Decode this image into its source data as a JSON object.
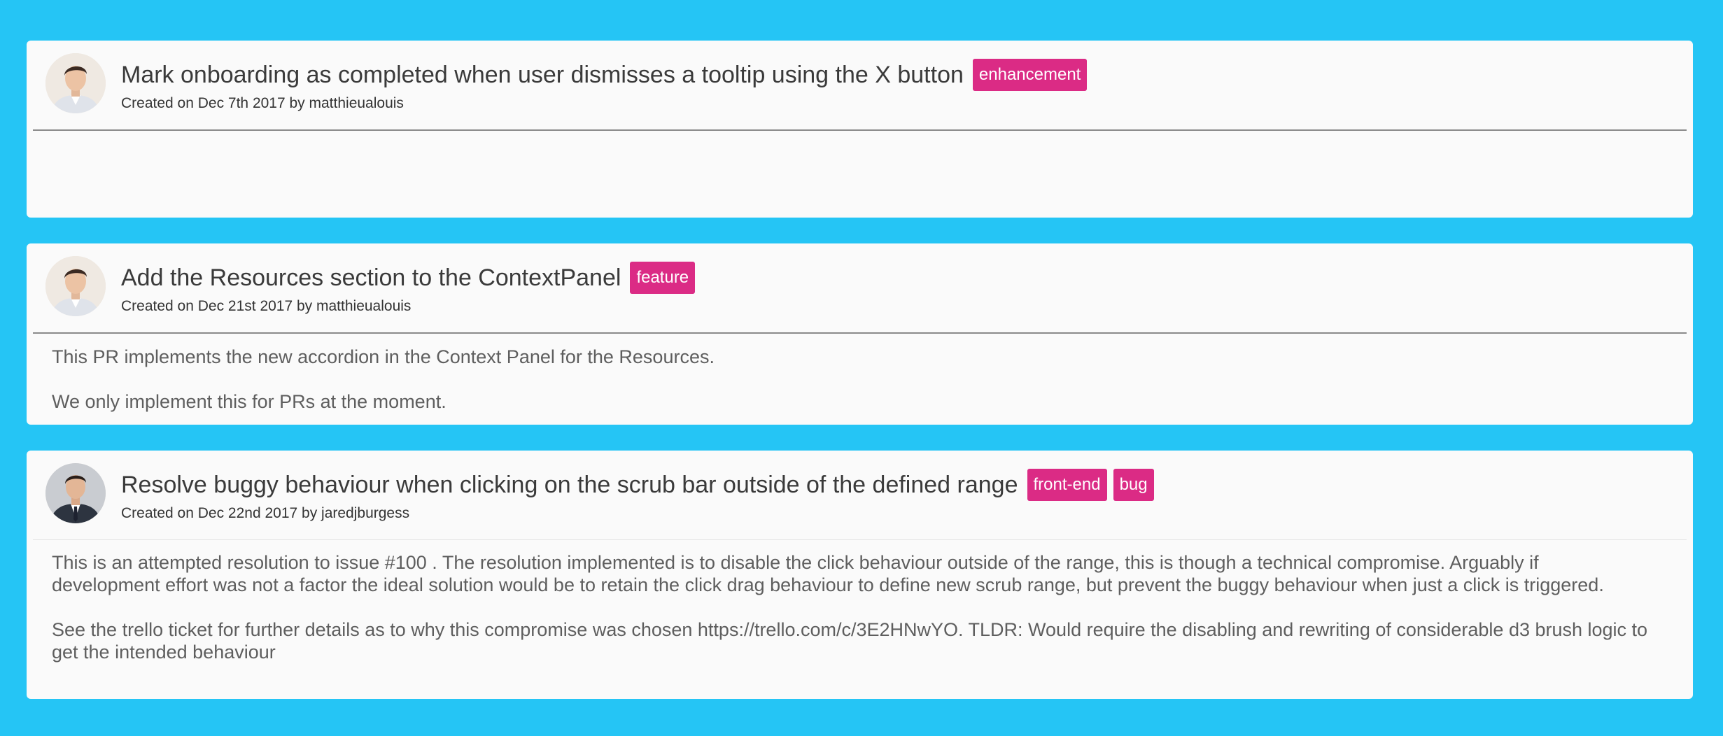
{
  "cards": [
    {
      "title": "Mark onboarding as completed when user dismisses a tooltip using the X button",
      "labels": [
        "enhancement"
      ],
      "meta": "Created on Dec 7th 2017 by matthieualouis",
      "body": [],
      "avatar": "user-avatar-matthieualouis"
    },
    {
      "title": "Add the Resources section to the ContextPanel",
      "labels": [
        "feature"
      ],
      "meta": "Created on Dec 21st 2017 by matthieualouis",
      "body": [
        "This PR implements the new accordion in the Context Panel for the Resources.",
        "We only implement this for PRs at the moment."
      ],
      "avatar": "user-avatar-matthieualouis"
    },
    {
      "title": "Resolve buggy behaviour when clicking on the scrub bar outside of the defined range",
      "labels": [
        "front-end",
        "bug"
      ],
      "meta": "Created on Dec 22nd 2017 by jaredjburgess",
      "body": [
        "This is an attempted resolution to issue #100 . The resolution implemented is to disable the click behaviour outside of the range, this is though a technical compromise. Arguably if development effort was not a factor the ideal solution would be to retain the click drag behaviour to define new scrub range, but prevent the buggy behaviour when just a click is triggered.",
        "See the trello ticket for further details as to why this compromise was chosen https://trello.com/c/3E2HNwYO. TLDR: Would require the disabling and rewriting of considerable d3 brush logic to get the intended behaviour"
      ],
      "avatar": "user-avatar-jaredjburgess"
    }
  ],
  "colors": {
    "background": "#25c5f5",
    "card": "#fafafa",
    "label": "#db2b85"
  }
}
